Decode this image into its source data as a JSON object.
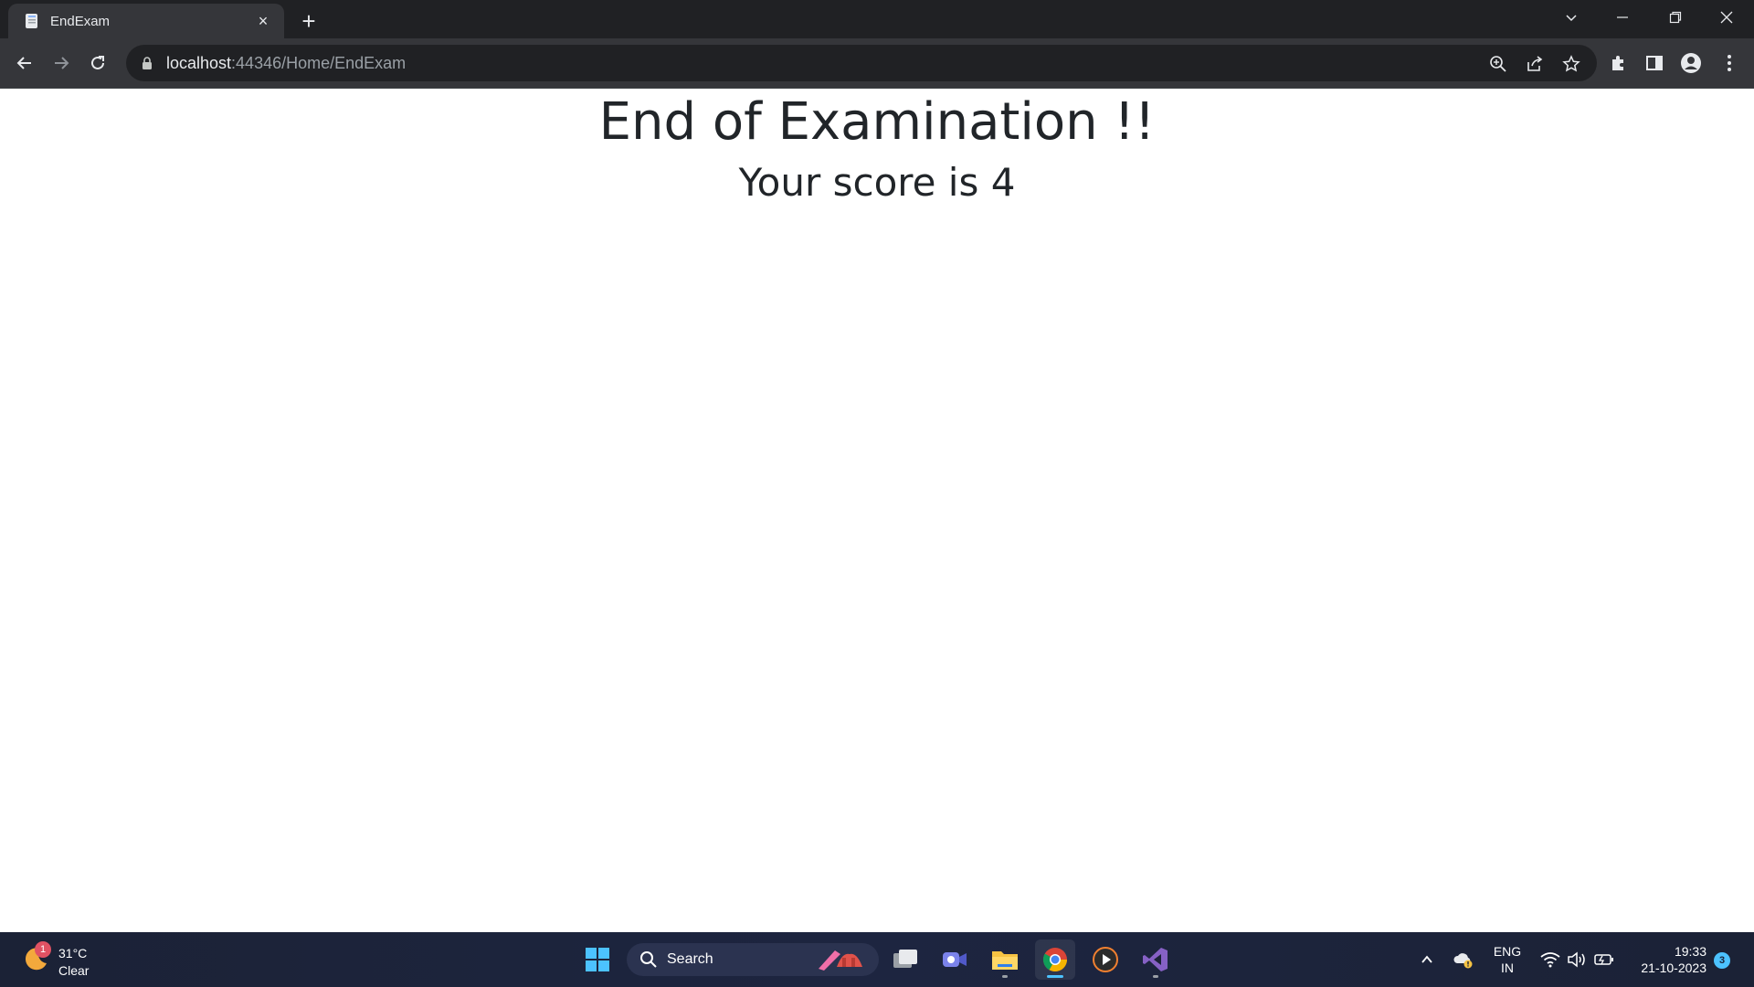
{
  "browser": {
    "tab_title": "EndExam",
    "new_tab_symbol": "+",
    "close_tab_symbol": "×",
    "url_host": "localhost",
    "url_rest": ":44346/Home/EndExam"
  },
  "page": {
    "heading": "End of Examination !!",
    "score_text": "Your score is 4"
  },
  "taskbar": {
    "weather_badge": "1",
    "weather_temp": "31°C",
    "weather_condition": "Clear",
    "search_label": "Search",
    "lang_line1": "ENG",
    "lang_line2": "IN",
    "time": "19:33",
    "date": "21-10-2023",
    "notification_count": "3"
  },
  "icons": [
    "page-icon",
    "close-icon",
    "plus-icon",
    "chevron-down-icon",
    "minimize-icon",
    "restore-icon",
    "window-close-icon",
    "back-icon",
    "forward-icon",
    "reload-icon",
    "lock-icon",
    "zoom-icon",
    "share-icon",
    "star-icon",
    "extensions-icon",
    "side-panel-icon",
    "profile-icon",
    "menu-icon",
    "windows-start-icon",
    "search-icon",
    "task-view-icon",
    "teams-icon",
    "file-explorer-icon",
    "chrome-icon",
    "media-player-icon",
    "visual-studio-icon",
    "chevron-up-icon",
    "onedrive-icon",
    "wifi-icon",
    "volume-icon",
    "battery-icon"
  ],
  "colors": {
    "accent": "#4cc2ff",
    "page_text": "#212529",
    "chrome_dark": "#202124",
    "chrome_toolbar": "#35363a"
  }
}
